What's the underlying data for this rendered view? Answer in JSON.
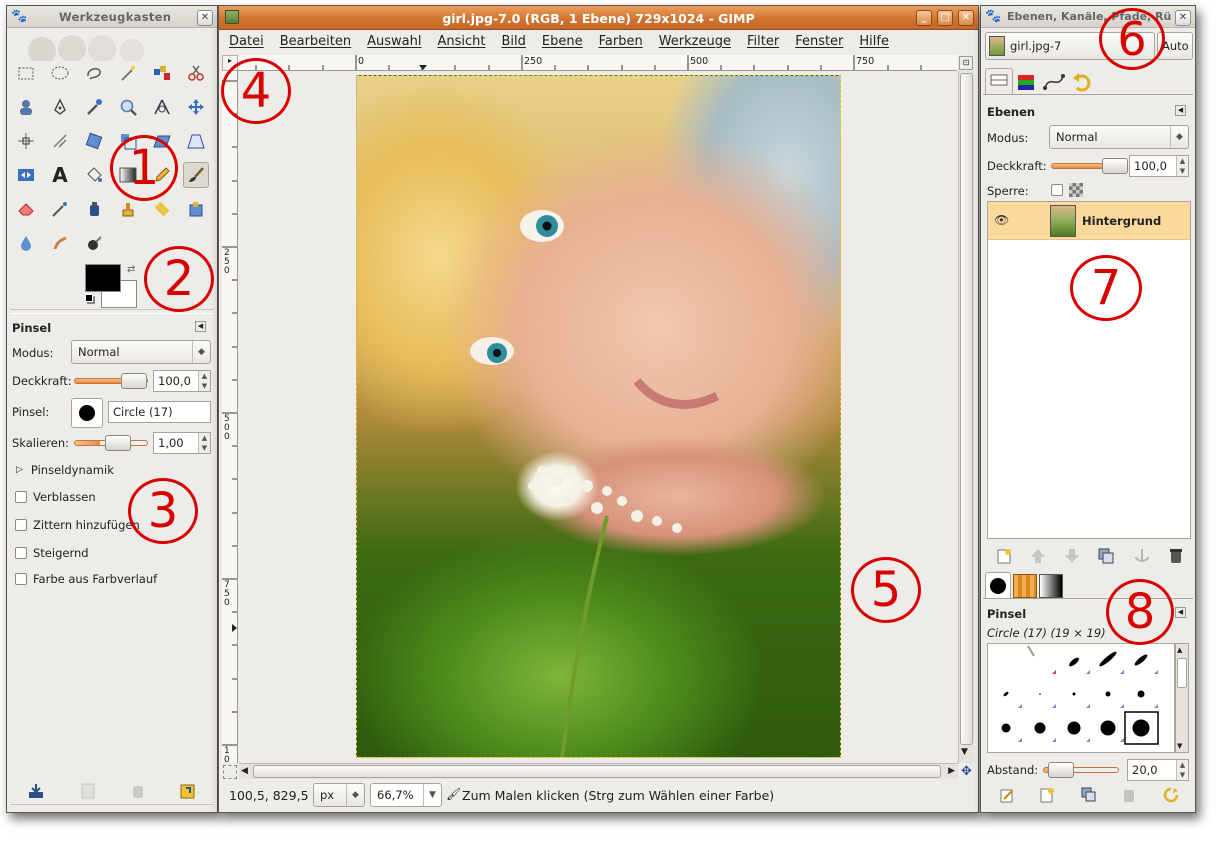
{
  "toolbox": {
    "title": "Werkzeugkasten",
    "tool_options": {
      "title": "Pinsel",
      "mode_label": "Modus:",
      "mode_value": "Normal",
      "opacity_label": "Deckkraft:",
      "opacity_value": "100,0",
      "brush_label": "Pinsel:",
      "brush_value": "Circle (17)",
      "scale_label": "Skalieren:",
      "scale_value": "1,00",
      "dynamics_label": "Pinseldynamik",
      "checks": [
        "Verblassen",
        "Zittern hinzufügen",
        "Steigernd",
        "Farbe aus Farbverlauf"
      ]
    }
  },
  "image_window": {
    "title": "girl.jpg-7.0 (RGB, 1 Ebene) 729x1024 - GIMP",
    "menu": [
      "Datei",
      "Bearbeiten",
      "Auswahl",
      "Ansicht",
      "Bild",
      "Ebene",
      "Farben",
      "Werkzeuge",
      "Filter",
      "Fenster",
      "Hilfe"
    ],
    "ruler_h": [
      "0",
      "250",
      "500",
      "750"
    ],
    "ruler_v": [
      "2\n5\n0",
      "5\n0\n0",
      "7\n5\n0",
      "1\n0"
    ],
    "status": {
      "coords": "100,5, 829,5",
      "unit": "px",
      "zoom": "66,7%",
      "hint": "Zum Malen klicken (Strg zum Wählen einer Farbe)"
    }
  },
  "layers_window": {
    "title": "Ebenen, Kanäle, Pfade, Rü",
    "image_select": "girl.jpg-7",
    "auto_label": "Auto",
    "layers": {
      "title": "Ebenen",
      "mode_label": "Modus:",
      "mode_value": "Normal",
      "opacity_label": "Deckkraft:",
      "opacity_value": "100,0",
      "lock_label": "Sperre:",
      "layer_name": "Hintergrund"
    },
    "brushes": {
      "title": "Pinsel",
      "current": "Circle (17) (19 × 19)",
      "spacing_label": "Abstand:",
      "spacing_value": "20,0"
    }
  },
  "markers": [
    "1",
    "2",
    "3",
    "4",
    "5",
    "6",
    "7",
    "8"
  ],
  "colors": {
    "accent": "#d2742f",
    "marker": "#d90000",
    "selected_layer": "#fbd99c"
  }
}
